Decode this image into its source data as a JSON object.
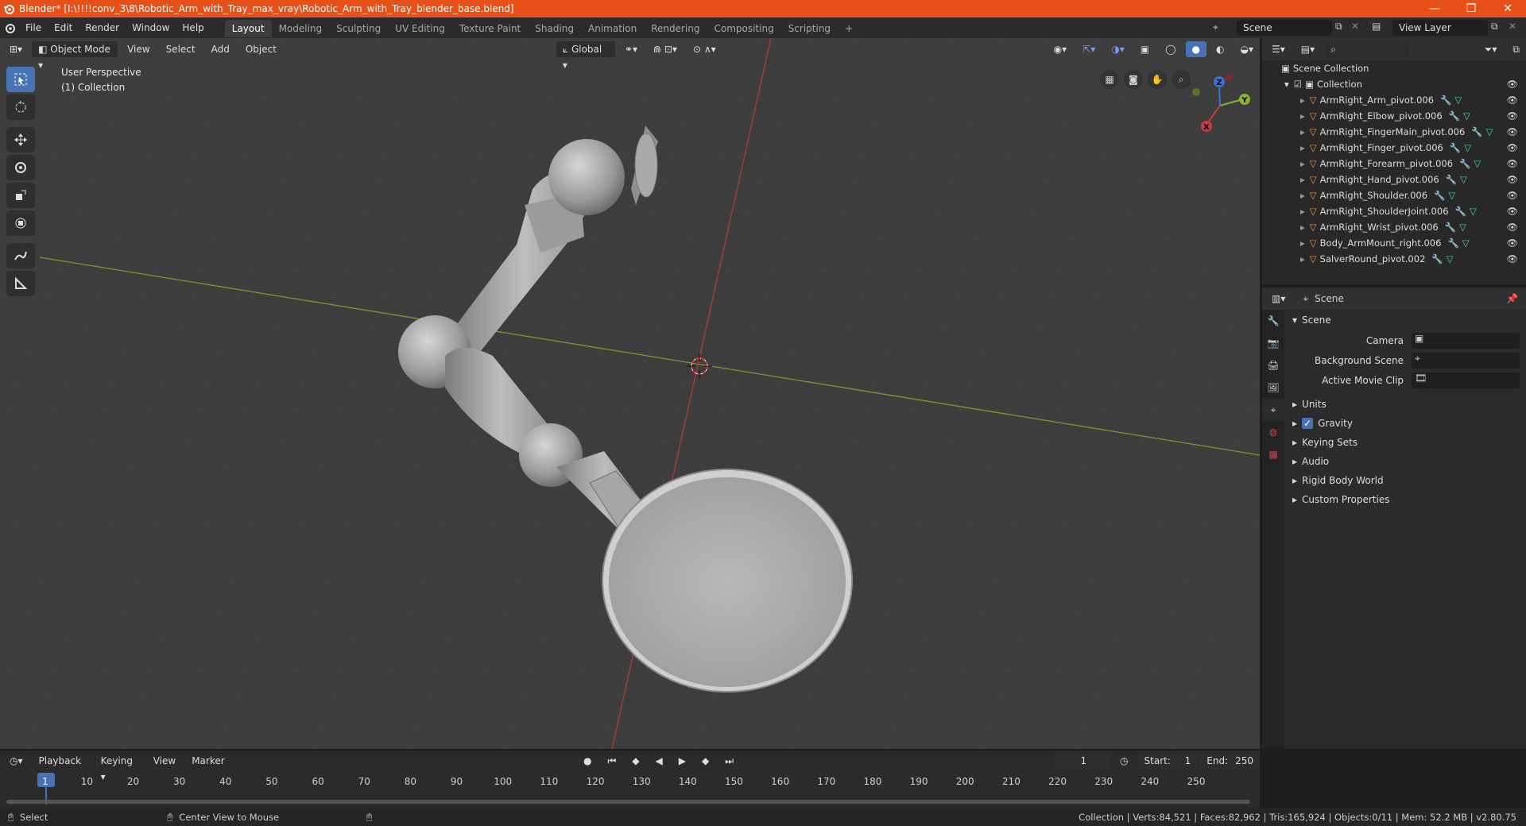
{
  "window": {
    "title": "Blender* [I:\\!!!!conv_3\\8\\Robotic_Arm_with_Tray_max_vray\\Robotic_Arm_with_Tray_blender_base.blend]",
    "minimize": "—",
    "maximize": "❐",
    "close": "✕"
  },
  "menu": [
    "File",
    "Edit",
    "Render",
    "Window",
    "Help"
  ],
  "workspaces": [
    "Layout",
    "Modeling",
    "Sculpting",
    "UV Editing",
    "Texture Paint",
    "Shading",
    "Animation",
    "Rendering",
    "Compositing",
    "Scripting"
  ],
  "active_workspace": "Layout",
  "scene_name": "Scene",
  "view_layer": "View Layer",
  "viewport": {
    "mode": "Object Mode",
    "menus": [
      "View",
      "Select",
      "Add",
      "Object"
    ],
    "transform_orientation": "Global",
    "perspective_label": "User Perspective",
    "collection_label": "(1) Collection"
  },
  "outliner": {
    "root": "Scene Collection",
    "collection": "Collection",
    "items": [
      "ArmRight_Arm_pivot.006",
      "ArmRight_Elbow_pivot.006",
      "ArmRight_FingerMain_pivot.006",
      "ArmRight_Finger_pivot.006",
      "ArmRight_Forearm_pivot.006",
      "ArmRight_Hand_pivot.006",
      "ArmRight_Shoulder.006",
      "ArmRight_ShoulderJoint.006",
      "ArmRight_Wrist_pivot.006",
      "Body_ArmMount_right.006",
      "SalverRound_pivot.002"
    ]
  },
  "properties": {
    "header": "Scene",
    "section": "Scene",
    "fields": [
      {
        "label": "Camera"
      },
      {
        "label": "Background Scene"
      },
      {
        "label": "Active Movie Clip"
      }
    ],
    "panels": [
      "Units",
      "Gravity",
      "Keying Sets",
      "Audio",
      "Rigid Body World",
      "Custom Properties"
    ]
  },
  "timeline": {
    "menus": [
      "Playback",
      "Keying",
      "View",
      "Marker"
    ],
    "current_frame": "1",
    "start_label": "Start:",
    "start": "1",
    "end_label": "End:",
    "end": "250",
    "ticks": [
      "1",
      "10",
      "20",
      "30",
      "40",
      "50",
      "60",
      "70",
      "80",
      "90",
      "100",
      "110",
      "120",
      "130",
      "140",
      "150",
      "160",
      "170",
      "180",
      "190",
      "200",
      "210",
      "220",
      "230",
      "240",
      "250"
    ]
  },
  "status": {
    "left": "Select",
    "middle": "Center View to Mouse",
    "right": "Collection | Verts:84,521 | Faces:82,962 | Tris:165,924 | Objects:0/11 | Mem: 52.2 MB | v2.80.75"
  },
  "colors": {
    "accent": "#4772b3",
    "titlebar": "#e8501a",
    "x_axis": "#c83b3b",
    "y_axis": "#8cb431",
    "z_axis": "#3b6fd6"
  }
}
